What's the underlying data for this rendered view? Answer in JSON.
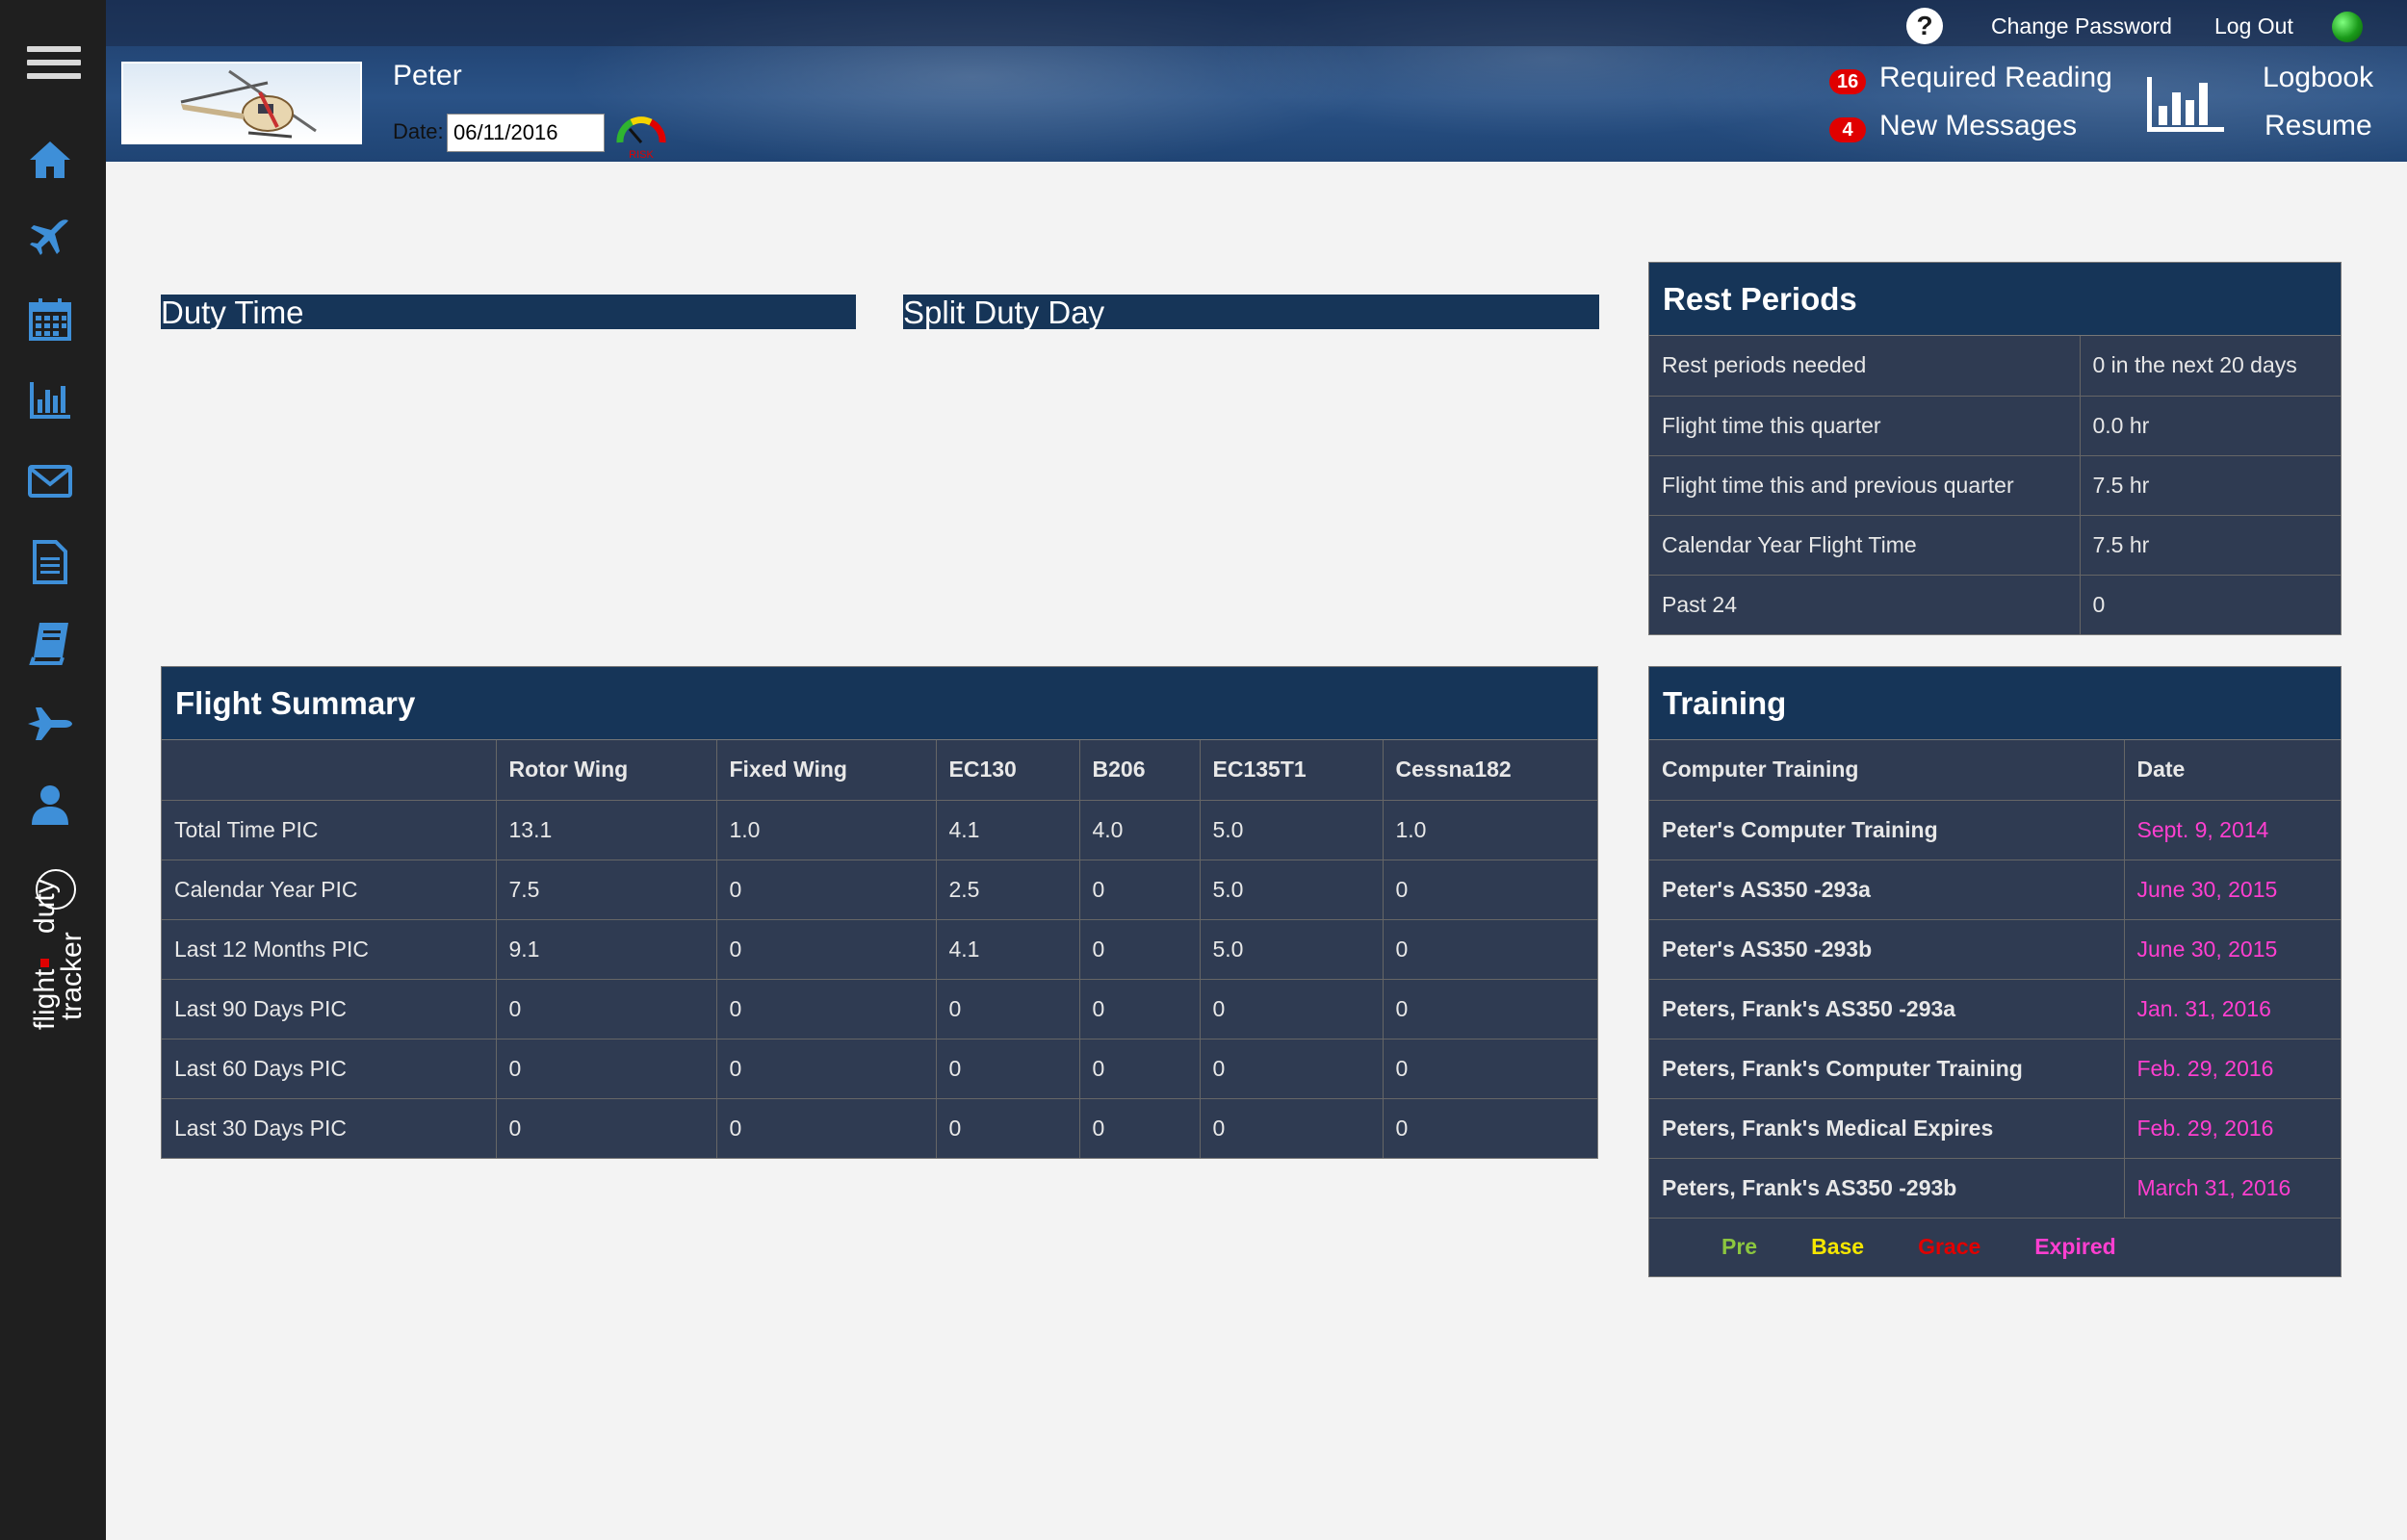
{
  "app": {
    "brand_line1": "flight",
    "brand_line2": "duty",
    "brand_line3": "tracker"
  },
  "sidebar": {
    "items": [
      {
        "icon": "home-icon"
      },
      {
        "icon": "airplane-icon"
      },
      {
        "icon": "calendar-icon"
      },
      {
        "icon": "bar-chart-icon"
      },
      {
        "icon": "envelope-icon"
      },
      {
        "icon": "document-icon"
      },
      {
        "icon": "book-icon"
      },
      {
        "icon": "jet-icon"
      },
      {
        "icon": "user-icon"
      }
    ]
  },
  "header": {
    "user_name": "Peter",
    "date_label": "Date:",
    "date_value": "06/11/2016",
    "risk_label": "RISK",
    "change_password": "Change Password",
    "log_out": "Log Out",
    "required_reading_count": "16",
    "required_reading_label": "Required Reading",
    "new_messages_count": "4",
    "new_messages_label": "New Messages",
    "logbook": "Logbook",
    "resume": "Resume"
  },
  "duty_time": {
    "title": "Duty Time"
  },
  "split_duty_day": {
    "title": "Split Duty Day"
  },
  "rest_periods": {
    "title": "Rest Periods",
    "rows": [
      {
        "label": "Rest periods needed",
        "value": "0 in the next 20 days"
      },
      {
        "label": "Flight time this quarter",
        "value": "0.0 hr"
      },
      {
        "label": "Flight time this and previous quarter",
        "value": "7.5 hr"
      },
      {
        "label": "Calendar Year Flight Time",
        "value": "7.5 hr"
      },
      {
        "label": "Past 24",
        "value": "0"
      }
    ]
  },
  "flight_summary": {
    "title": "Flight Summary",
    "columns": [
      "",
      "Rotor Wing",
      "Fixed Wing",
      "EC130",
      "B206",
      "EC135T1",
      "Cessna182"
    ],
    "rows": [
      {
        "label": "Total Time PIC",
        "values": [
          "13.1",
          "1.0",
          "4.1",
          "4.0",
          "5.0",
          "1.0"
        ]
      },
      {
        "label": "Calendar Year PIC",
        "values": [
          "7.5",
          "0",
          "2.5",
          "0",
          "5.0",
          "0"
        ]
      },
      {
        "label": "Last 12 Months PIC",
        "values": [
          "9.1",
          "0",
          "4.1",
          "0",
          "5.0",
          "0"
        ]
      },
      {
        "label": "Last 90 Days PIC",
        "values": [
          "0",
          "0",
          "0",
          "0",
          "0",
          "0"
        ]
      },
      {
        "label": "Last 60 Days PIC",
        "values": [
          "0",
          "0",
          "0",
          "0",
          "0",
          "0"
        ]
      },
      {
        "label": "Last 30 Days PIC",
        "values": [
          "0",
          "0",
          "0",
          "0",
          "0",
          "0"
        ]
      }
    ]
  },
  "training": {
    "title": "Training",
    "columns": [
      "Computer Training",
      "Date"
    ],
    "rows": [
      {
        "name": "Peter's Computer Training",
        "date": "Sept. 9, 2014"
      },
      {
        "name": "Peter's AS350 -293a",
        "date": "June 30, 2015"
      },
      {
        "name": "Peter's AS350 -293b",
        "date": "June 30, 2015"
      },
      {
        "name": "Peters, Frank's AS350 -293a",
        "date": "Jan. 31, 2016"
      },
      {
        "name": "Peters, Frank's Computer Training",
        "date": "Feb. 29, 2016"
      },
      {
        "name": "Peters, Frank's Medical Expires",
        "date": "Feb. 29, 2016"
      },
      {
        "name": "Peters, Frank's AS350 -293b",
        "date": "March 31, 2016"
      }
    ],
    "legend": [
      {
        "label": "Pre",
        "color": "#8cc63f"
      },
      {
        "label": "Base",
        "color": "#f5e600"
      },
      {
        "label": "Grace",
        "color": "#e00000"
      },
      {
        "label": "Expired",
        "color": "#ff3fd0"
      }
    ]
  }
}
